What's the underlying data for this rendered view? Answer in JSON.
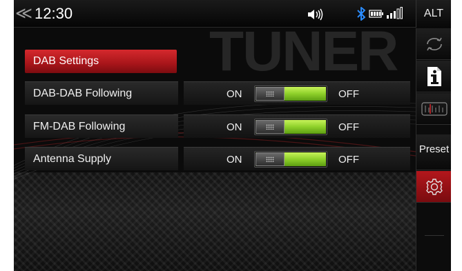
{
  "status_bar": {
    "back_glyph": "≪",
    "time": "12:30",
    "icons": [
      "volume-icon",
      "bluetooth-icon",
      "battery-icon",
      "signal-icon"
    ],
    "alt_label": "ALT"
  },
  "watermark": "TUNER",
  "menu": {
    "header": "DAB Settings",
    "rows": [
      {
        "label": "DAB-DAB Following",
        "on_label": "ON",
        "off_label": "OFF",
        "state": "on"
      },
      {
        "label": "FM-DAB Following",
        "on_label": "ON",
        "off_label": "OFF",
        "state": "on"
      },
      {
        "label": "Antenna Supply",
        "on_label": "ON",
        "off_label": "OFF",
        "state": "on"
      }
    ]
  },
  "rail": {
    "items": [
      {
        "icon": "sync-icon"
      },
      {
        "icon": "info-icon"
      },
      {
        "icon": "tuner-scale-icon"
      },
      {
        "label": "Preset"
      },
      {
        "icon": "gear-icon",
        "active": true
      }
    ]
  },
  "colors": {
    "accent_red": "#b3171c",
    "toggle_green": "#8ed02a",
    "bluetooth_blue": "#2a8cff"
  }
}
